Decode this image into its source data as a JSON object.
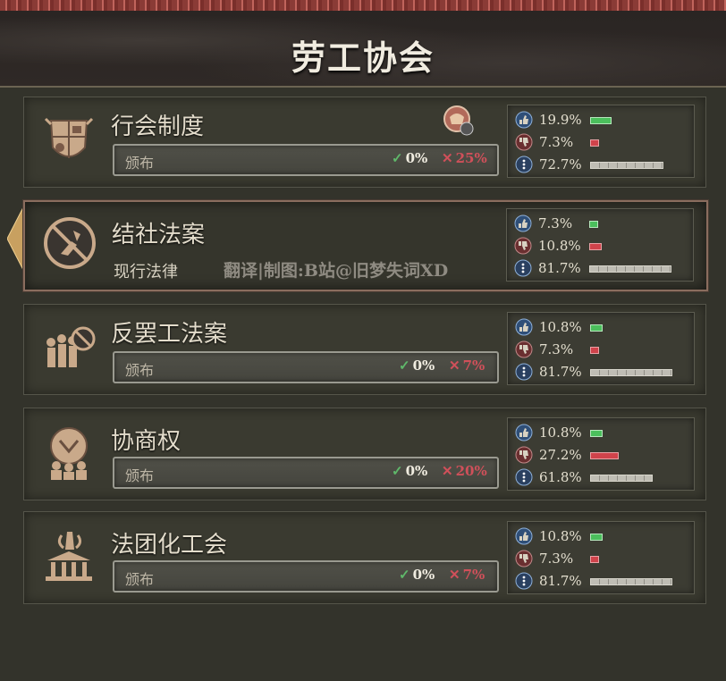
{
  "title": "劳工协会",
  "colors": {
    "support": "#4bbf5c",
    "oppose": "#d0434b",
    "neutral": "#bfbdb4",
    "fail": "#d0505a"
  },
  "watermark": "翻译|制图:B站@旧梦失词XD",
  "laws": [
    {
      "name": "行会制度",
      "icon": "guild-shield-icon",
      "status_label": "颁布",
      "pass": "0%",
      "fail": "25%",
      "support": {
        "approve": "19.9%",
        "disapprove": "7.3%",
        "neutral": "72.7%"
      },
      "support_frac": {
        "approve": 0.199,
        "disapprove": 0.073,
        "neutral": 0.727
      }
    },
    {
      "name": "结社法案",
      "icon": "no-association-icon",
      "status_label": "现行法律",
      "support": {
        "approve": "7.3%",
        "disapprove": "10.8%",
        "neutral": "81.7%"
      },
      "support_frac": {
        "approve": 0.073,
        "disapprove": 0.108,
        "neutral": 0.817
      }
    },
    {
      "name": "反罢工法案",
      "icon": "anti-strike-icon",
      "status_label": "颁布",
      "pass": "0%",
      "fail": "7%",
      "support": {
        "approve": "10.8%",
        "disapprove": "7.3%",
        "neutral": "81.7%"
      },
      "support_frac": {
        "approve": 0.108,
        "disapprove": 0.073,
        "neutral": 0.817
      }
    },
    {
      "name": "协商权",
      "icon": "bargaining-icon",
      "status_label": "颁布",
      "pass": "0%",
      "fail": "20%",
      "support": {
        "approve": "10.8%",
        "disapprove": "27.2%",
        "neutral": "61.8%"
      },
      "support_frac": {
        "approve": 0.108,
        "disapprove": 0.272,
        "neutral": 0.618
      }
    },
    {
      "name": "法团化工会",
      "icon": "corporate-union-icon",
      "status_label": "颁布",
      "pass": "0%",
      "fail": "7%",
      "support": {
        "approve": "10.8%",
        "disapprove": "7.3%",
        "neutral": "81.7%"
      },
      "support_frac": {
        "approve": 0.108,
        "disapprove": 0.073,
        "neutral": 0.817
      }
    }
  ]
}
